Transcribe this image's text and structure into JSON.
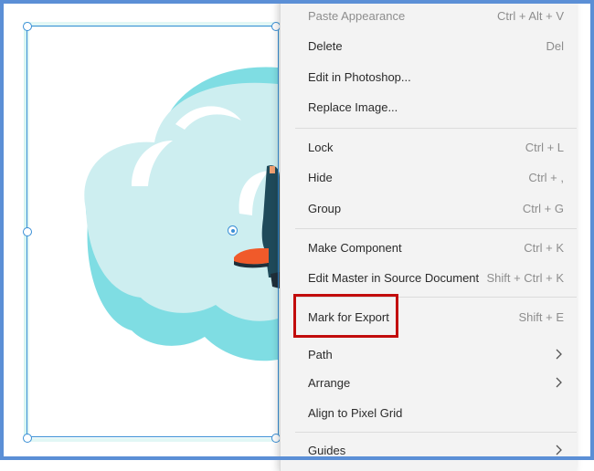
{
  "colors": {
    "accent": "#3a8fd6",
    "highlight": "#c20c0c",
    "frame": "#5b8fd6",
    "cloud_light": "#cdeef0",
    "cloud_dark": "#7fdde3"
  },
  "context_menu": {
    "items": [
      {
        "label": "Paste Appearance",
        "shortcut": "Ctrl + Alt + V",
        "disabled": true
      },
      {
        "label": "Delete",
        "shortcut": "Del"
      },
      {
        "label": "Edit in Photoshop...",
        "shortcut": ""
      },
      {
        "label": "Replace Image...",
        "shortcut": ""
      },
      {
        "label": "Lock",
        "shortcut": "Ctrl + L"
      },
      {
        "label": "Hide",
        "shortcut": "Ctrl + ,"
      },
      {
        "label": "Group",
        "shortcut": "Ctrl + G"
      },
      {
        "label": "Make Component",
        "shortcut": "Ctrl + K"
      },
      {
        "label": "Edit Master in Source Document",
        "shortcut": "Shift + Ctrl + K"
      },
      {
        "label": "Mark for Export",
        "shortcut": "Shift + E",
        "highlighted": true
      },
      {
        "label": "Path",
        "submenu_icon": "chevron-right-icon"
      },
      {
        "label": "Arrange",
        "submenu_icon": "chevron-right-icon"
      },
      {
        "label": "Align to Pixel Grid",
        "shortcut": ""
      },
      {
        "label": "Guides",
        "submenu_icon": "chevron-right-icon"
      }
    ]
  }
}
